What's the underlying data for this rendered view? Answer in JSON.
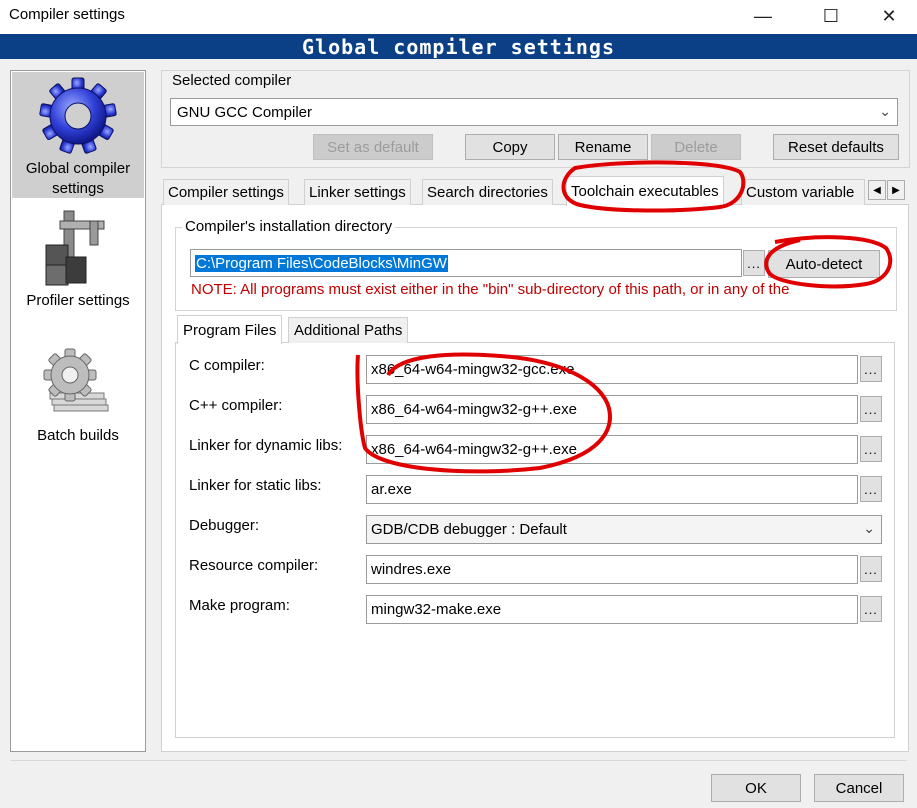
{
  "window": {
    "title": "Compiler settings",
    "minimize_icon": "minimize-icon",
    "maximize_icon": "maximize-icon",
    "close_icon": "close-icon",
    "minimize_glyph": "—",
    "maximize_glyph": "☐",
    "close_glyph": "✕"
  },
  "banner": {
    "title": "Global compiler settings"
  },
  "sidebar": {
    "items": [
      {
        "label_line1": "Global compiler",
        "label_line2": "settings",
        "icon": "gear-icon",
        "selected": true
      },
      {
        "label_line1": "Profiler settings",
        "icon": "caliper-icon",
        "selected": false
      },
      {
        "label_line1": "Batch builds",
        "icon": "batch-gear-icon",
        "selected": false
      }
    ]
  },
  "selected_compiler": {
    "group_label": "Selected compiler",
    "value": "GNU GCC Compiler",
    "buttons": {
      "set_default": "Set as default",
      "copy": "Copy",
      "rename": "Rename",
      "delete": "Delete",
      "reset": "Reset defaults"
    }
  },
  "tabs": [
    {
      "label": "Compiler settings",
      "active": false
    },
    {
      "label": "Linker settings",
      "active": false
    },
    {
      "label": "Search directories",
      "active": false
    },
    {
      "label": "Toolchain executables",
      "active": true
    },
    {
      "label": "Custom variable",
      "active": false
    }
  ],
  "tab_scroll": {
    "left": "◀",
    "right": "▶"
  },
  "install_dir": {
    "group_label": "Compiler's installation directory",
    "value": "C:\\Program Files\\CodeBlocks\\MinGW",
    "browse": "...",
    "autodetect": "Auto-detect",
    "note": "NOTE: All programs must exist either in the \"bin\" sub-directory of this path, or in any of the"
  },
  "subtabs": [
    {
      "label": "Program Files",
      "active": true
    },
    {
      "label": "Additional Paths",
      "active": false
    }
  ],
  "programs": [
    {
      "label": "C compiler:",
      "value": "x86_64-w64-mingw32-gcc.exe",
      "type": "text"
    },
    {
      "label": "C++ compiler:",
      "value": "x86_64-w64-mingw32-g++.exe",
      "type": "text"
    },
    {
      "label": "Linker for dynamic libs:",
      "value": "x86_64-w64-mingw32-g++.exe",
      "type": "text"
    },
    {
      "label": "Linker for static libs:",
      "value": "ar.exe",
      "type": "text"
    },
    {
      "label": "Debugger:",
      "value": "GDB/CDB debugger : Default",
      "type": "select"
    },
    {
      "label": "Resource compiler:",
      "value": "windres.exe",
      "type": "text"
    },
    {
      "label": "Make program:",
      "value": "mingw32-make.exe",
      "type": "text"
    }
  ],
  "browse_label": "...",
  "dropdown_glyph": "⌄",
  "footer": {
    "ok": "OK",
    "cancel": "Cancel"
  },
  "annotation_color": "#e00000"
}
